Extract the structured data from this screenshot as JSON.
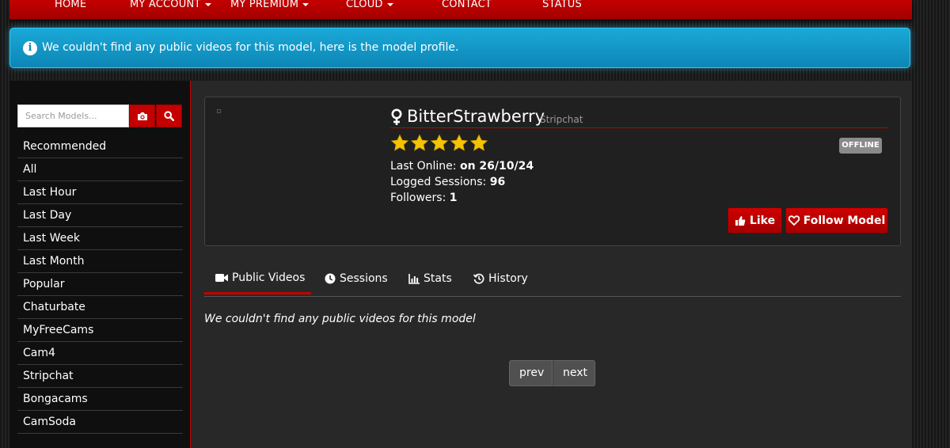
{
  "nav": {
    "items": [
      {
        "label": "HOME",
        "dropdown": false
      },
      {
        "label": "MY ACCOUNT",
        "dropdown": true
      },
      {
        "label": "MY PREMIUM",
        "dropdown": true
      },
      {
        "label": "CLOUD",
        "dropdown": true
      },
      {
        "label": "CONTACT",
        "dropdown": false
      },
      {
        "label": "STATUS",
        "dropdown": false
      }
    ]
  },
  "alert": {
    "text": "We couldn't find any public videos for this model, here is the model profile.",
    "icon": "info-icon"
  },
  "sidebar": {
    "search_placeholder": "Search Models...",
    "items": [
      {
        "label": "Recommended"
      },
      {
        "label": "All"
      },
      {
        "label": "Last Hour"
      },
      {
        "label": "Last Day"
      },
      {
        "label": "Last Week"
      },
      {
        "label": "Last Month"
      },
      {
        "label": "Popular"
      },
      {
        "label": "Chaturbate"
      },
      {
        "label": "MyFreeCams"
      },
      {
        "label": "Cam4"
      },
      {
        "label": "Stripchat"
      },
      {
        "label": "Bongacams"
      },
      {
        "label": "CamSoda"
      }
    ]
  },
  "profile": {
    "name": "BitterStrawberry",
    "site": "Stripchat",
    "gender_icon": "venus-icon",
    "rating": 5,
    "status": "OFFLINE",
    "last_online_label": "Last Online:",
    "last_online_value": "on 26/10/24",
    "sessions_label": "Logged Sessions:",
    "sessions_value": "96",
    "followers_label": "Followers:",
    "followers_value": "1",
    "like_label": "Like",
    "follow_label": "Follow Model"
  },
  "tabs": [
    {
      "label": "Public Videos",
      "icon": "video-icon",
      "active": true
    },
    {
      "label": "Sessions",
      "icon": "clock-icon",
      "active": false
    },
    {
      "label": "Stats",
      "icon": "chart-icon",
      "active": false
    },
    {
      "label": "History",
      "icon": "history-icon",
      "active": false
    }
  ],
  "content": {
    "empty_message": "We couldn't find any public videos for this model"
  },
  "pager": {
    "prev": "prev",
    "next": "next"
  },
  "colors": {
    "brand_red": "#c40000",
    "alert_blue": "#1aa9d8",
    "star_yellow": "#f5c400",
    "badge_gray": "#8a8a8a"
  }
}
